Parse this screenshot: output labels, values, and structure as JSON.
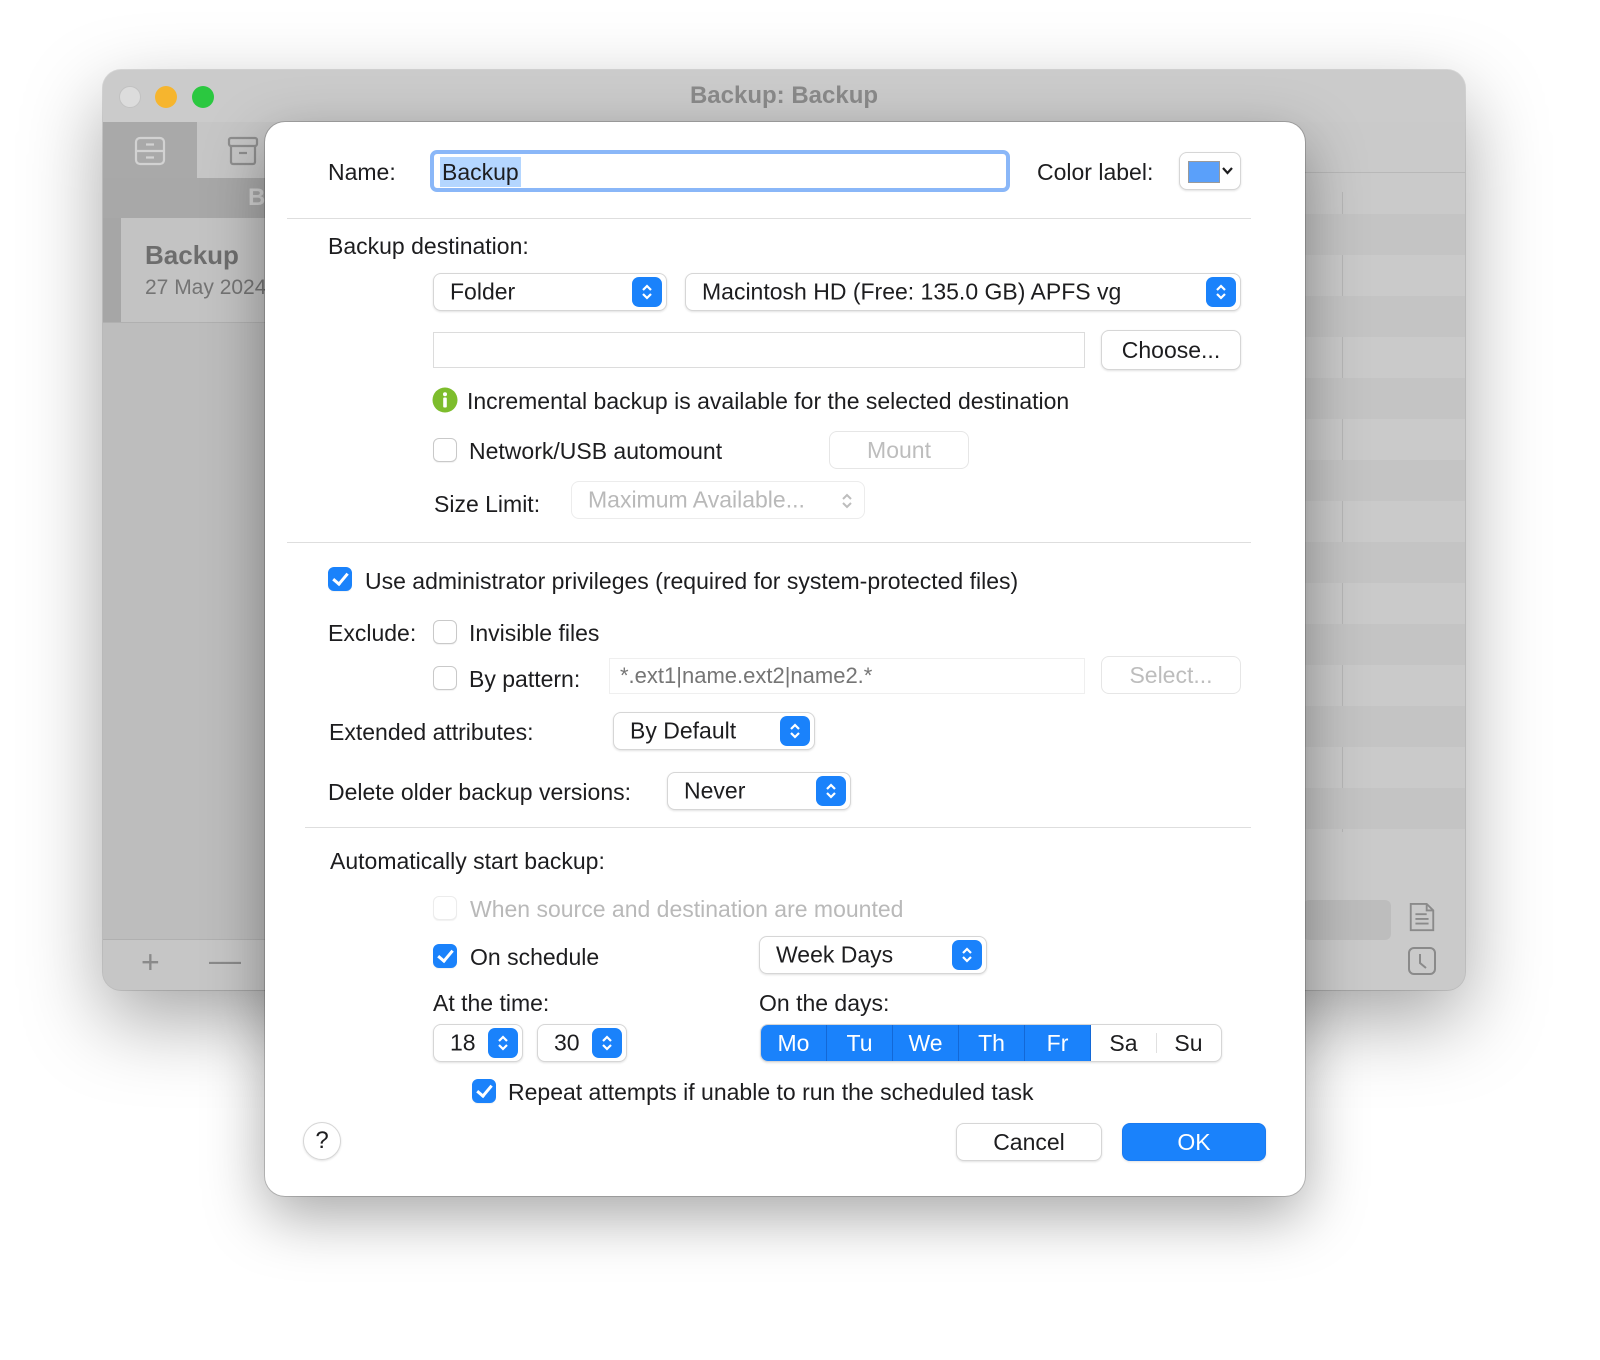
{
  "window": {
    "title": "Backup: Backup",
    "sidebar_header": "B",
    "sidebar_item": {
      "name": "Backup",
      "date": "27 May 2024"
    },
    "add_symbol": "+",
    "remove_symbol": "—"
  },
  "sheet": {
    "name_label": "Name:",
    "name_value": "Backup",
    "color_label_label": "Color label:",
    "color_label_value": "#5aa0fa",
    "destination": {
      "label": "Backup destination:",
      "type_popup": "Folder",
      "volume_popup": "Macintosh HD (Free: 135.0 GB) APFS vg",
      "path_value": "",
      "choose_button": "Choose...",
      "info_text": "Incremental backup is available for the selected destination",
      "automount_label": "Network/USB automount",
      "automount_checked": false,
      "mount_button": "Mount",
      "size_limit_label": "Size Limit:",
      "size_limit_popup": "Maximum Available..."
    },
    "options": {
      "admin_label": "Use administrator privileges (required for system-protected files)",
      "admin_checked": true,
      "exclude_label": "Exclude:",
      "invisible_label": "Invisible files",
      "invisible_checked": false,
      "pattern_label": "By pattern:",
      "pattern_checked": false,
      "pattern_placeholder": "*.ext1|name.ext2|name2.*",
      "select_button": "Select...",
      "ext_attr_label": "Extended attributes:",
      "ext_attr_value": "By Default",
      "delete_label": "Delete older backup versions:",
      "delete_value": "Never"
    },
    "schedule": {
      "label": "Automatically start backup:",
      "mounted_label": "When source and destination are mounted",
      "mounted_checked": false,
      "on_schedule_label": "On schedule",
      "on_schedule_checked": true,
      "frequency_value": "Week Days",
      "time_label": "At the time:",
      "hour": "18",
      "minute": "30",
      "days_label": "On the days:",
      "days": [
        {
          "label": "Mo",
          "selected": true
        },
        {
          "label": "Tu",
          "selected": true
        },
        {
          "label": "We",
          "selected": true
        },
        {
          "label": "Th",
          "selected": true
        },
        {
          "label": "Fr",
          "selected": true
        },
        {
          "label": "Sa",
          "selected": false
        },
        {
          "label": "Su",
          "selected": false
        }
      ],
      "repeat_label": "Repeat attempts if unable to run the scheduled task",
      "repeat_checked": true
    },
    "help_button": "?",
    "cancel_button": "Cancel",
    "ok_button": "OK",
    "accent_color": "#1a82fb"
  }
}
